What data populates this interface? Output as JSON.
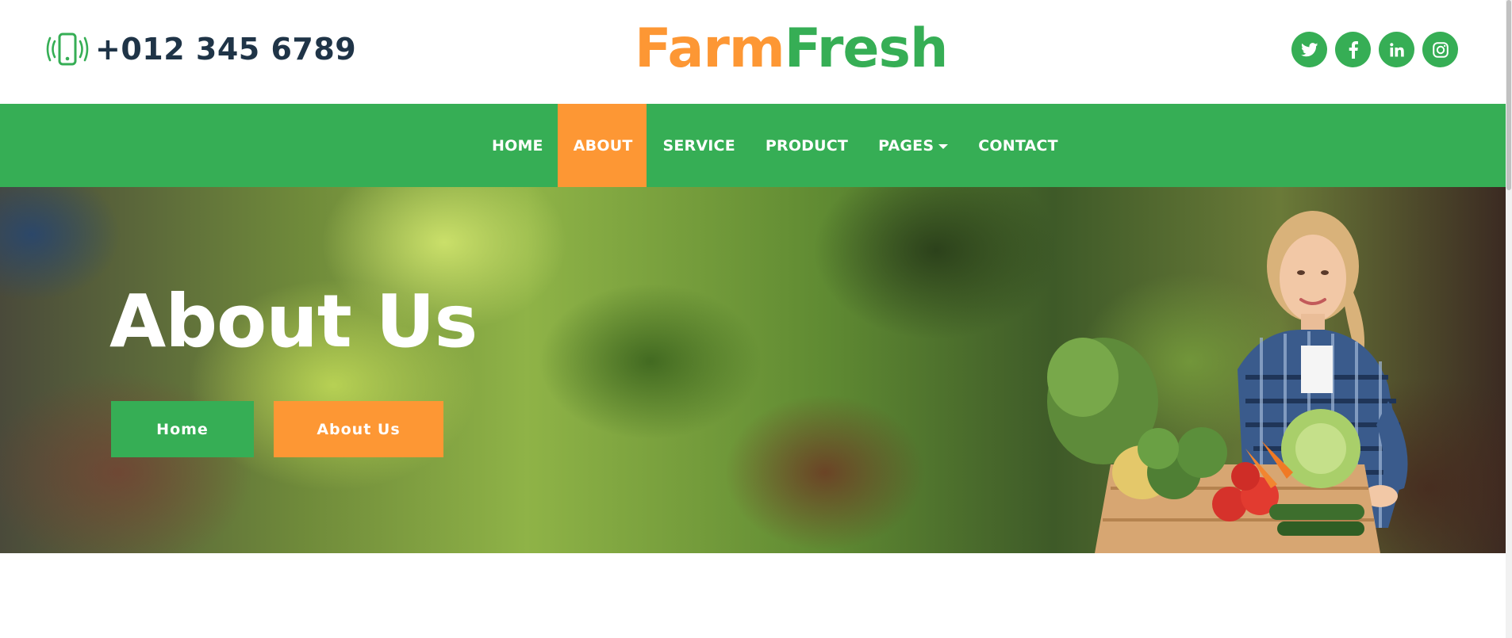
{
  "header": {
    "phone": "+012 345 6789",
    "phone_icon": "mobile-phone-vibrate-icon",
    "logo_part1": "Farm",
    "logo_part2": "Fresh",
    "socials": [
      {
        "name": "twitter",
        "icon": "twitter-icon"
      },
      {
        "name": "facebook",
        "icon": "facebook-icon"
      },
      {
        "name": "linkedin",
        "icon": "linkedin-icon"
      },
      {
        "name": "instagram",
        "icon": "instagram-icon"
      }
    ]
  },
  "nav": {
    "items": [
      "HOME",
      "ABOUT",
      "SERVICE",
      "PRODUCT",
      "PAGES",
      "CONTACT"
    ],
    "active": "ABOUT"
  },
  "hero": {
    "title": "About Us",
    "breadcrumb_home": "Home",
    "breadcrumb_current": "About Us"
  },
  "colors": {
    "primary_green": "#36ae55",
    "accent_orange": "#fd9734",
    "dark_text": "#1f3447",
    "white": "#ffffff"
  }
}
